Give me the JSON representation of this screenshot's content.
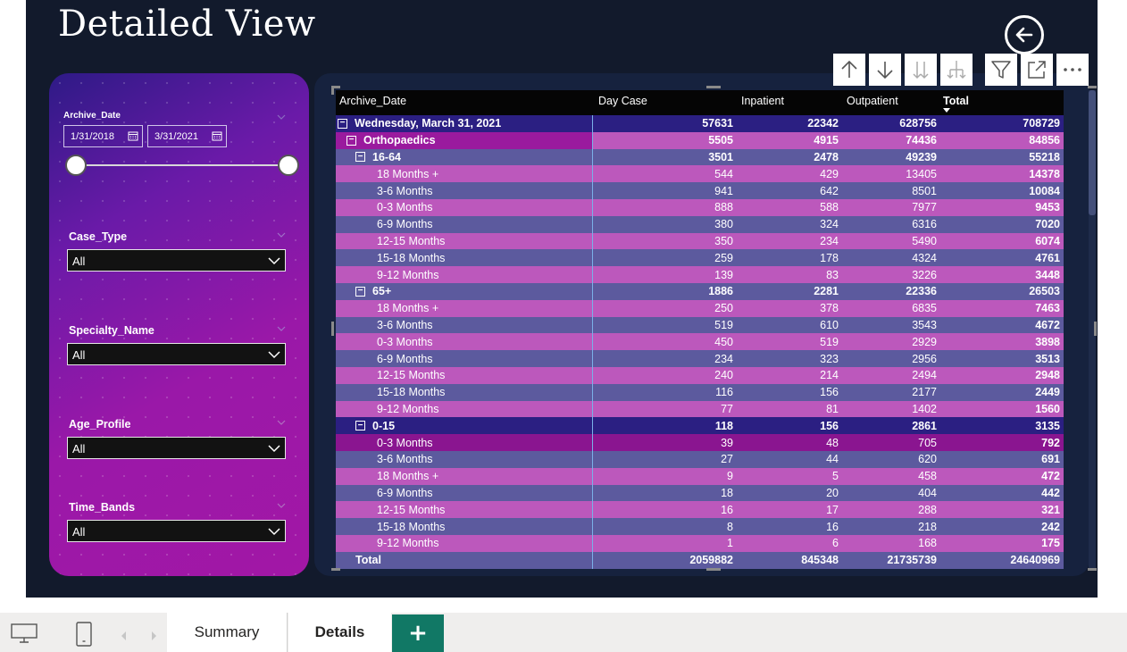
{
  "page": {
    "title": "Detailed View"
  },
  "filters": {
    "archive_date": {
      "label": "Archive_Date",
      "start": "1/31/2018",
      "end": "3/31/2021"
    },
    "case_type": {
      "label": "Case_Type",
      "value": "All"
    },
    "specialty_name": {
      "label": "Specialty_Name",
      "value": "All"
    },
    "age_profile": {
      "label": "Age_Profile",
      "value": "All"
    },
    "time_bands": {
      "label": "Time_Bands",
      "value": "All"
    }
  },
  "matrix": {
    "columns": [
      "Archive_Date",
      "Day Case",
      "Inpatient",
      "Outpatient",
      "Total"
    ],
    "rows": [
      {
        "label": "Wednesday, March 31, 2021",
        "level": 0,
        "exp": true,
        "kind": "date",
        "v": [
          "57631",
          "22342",
          "628756",
          "708729"
        ]
      },
      {
        "label": "Orthopaedics",
        "level": 1,
        "exp": true,
        "kind": "spec",
        "v": [
          "5505",
          "4915",
          "74436",
          "84856"
        ]
      },
      {
        "label": "16-64",
        "level": 2,
        "exp": true,
        "kind": "age",
        "v": [
          "3501",
          "2478",
          "49239",
          "55218"
        ]
      },
      {
        "label": "18 Months +",
        "level": 3,
        "v": [
          "544",
          "429",
          "13405",
          "14378"
        ]
      },
      {
        "label": "3-6 Months",
        "level": 3,
        "v": [
          "941",
          "642",
          "8501",
          "10084"
        ]
      },
      {
        "label": "0-3 Months",
        "level": 3,
        "v": [
          "888",
          "588",
          "7977",
          "9453"
        ]
      },
      {
        "label": "6-9 Months",
        "level": 3,
        "v": [
          "380",
          "324",
          "6316",
          "7020"
        ]
      },
      {
        "label": "12-15 Months",
        "level": 3,
        "v": [
          "350",
          "234",
          "5490",
          "6074"
        ]
      },
      {
        "label": "15-18 Months",
        "level": 3,
        "v": [
          "259",
          "178",
          "4324",
          "4761"
        ]
      },
      {
        "label": "9-12 Months",
        "level": 3,
        "v": [
          "139",
          "83",
          "3226",
          "3448"
        ]
      },
      {
        "label": "65+",
        "level": 2,
        "exp": true,
        "kind": "age",
        "v": [
          "1886",
          "2281",
          "22336",
          "26503"
        ]
      },
      {
        "label": "18 Months +",
        "level": 3,
        "v": [
          "250",
          "378",
          "6835",
          "7463"
        ]
      },
      {
        "label": "3-6 Months",
        "level": 3,
        "v": [
          "519",
          "610",
          "3543",
          "4672"
        ]
      },
      {
        "label": "0-3 Months",
        "level": 3,
        "v": [
          "450",
          "519",
          "2929",
          "3898"
        ]
      },
      {
        "label": "6-9 Months",
        "level": 3,
        "v": [
          "234",
          "323",
          "2956",
          "3513"
        ]
      },
      {
        "label": "12-15 Months",
        "level": 3,
        "v": [
          "240",
          "214",
          "2494",
          "2948"
        ]
      },
      {
        "label": "15-18 Months",
        "level": 3,
        "v": [
          "116",
          "156",
          "2177",
          "2449"
        ]
      },
      {
        "label": "9-12 Months",
        "level": 3,
        "v": [
          "77",
          "81",
          "1402",
          "1560"
        ]
      },
      {
        "label": "0-15",
        "level": 2,
        "exp": true,
        "kind": "age-hl",
        "v": [
          "118",
          "156",
          "2861",
          "3135"
        ]
      },
      {
        "label": "0-3 Months",
        "level": 3,
        "kind": "sel",
        "v": [
          "39",
          "48",
          "705",
          "792"
        ]
      },
      {
        "label": "3-6 Months",
        "level": 3,
        "v": [
          "27",
          "44",
          "620",
          "691"
        ]
      },
      {
        "label": "18 Months +",
        "level": 3,
        "v": [
          "9",
          "5",
          "458",
          "472"
        ]
      },
      {
        "label": "6-9 Months",
        "level": 3,
        "v": [
          "18",
          "20",
          "404",
          "442"
        ]
      },
      {
        "label": "12-15 Months",
        "level": 3,
        "v": [
          "16",
          "17",
          "288",
          "321"
        ]
      },
      {
        "label": "15-18 Months",
        "level": 3,
        "v": [
          "8",
          "16",
          "218",
          "242"
        ]
      },
      {
        "label": "9-12 Months",
        "level": 3,
        "v": [
          "1",
          "6",
          "168",
          "175"
        ]
      }
    ],
    "total": {
      "label": "Total",
      "v": [
        "2059882",
        "845348",
        "21735739",
        "24640969"
      ]
    }
  },
  "tabs": {
    "summary": "Summary",
    "details": "Details",
    "add": "+"
  },
  "colors": {
    "background": "#121a2c",
    "row_a": "#5c5a9e",
    "row_b": "#bc58bc",
    "accent_tab": "#117865"
  },
  "icons": [
    "back-arrow-icon",
    "drill-up-icon",
    "drill-down-icon",
    "expand-all-icon",
    "expand-hierarchy-icon",
    "filter-icon",
    "focus-mode-icon",
    "more-options-icon",
    "desktop-icon",
    "phone-icon"
  ]
}
